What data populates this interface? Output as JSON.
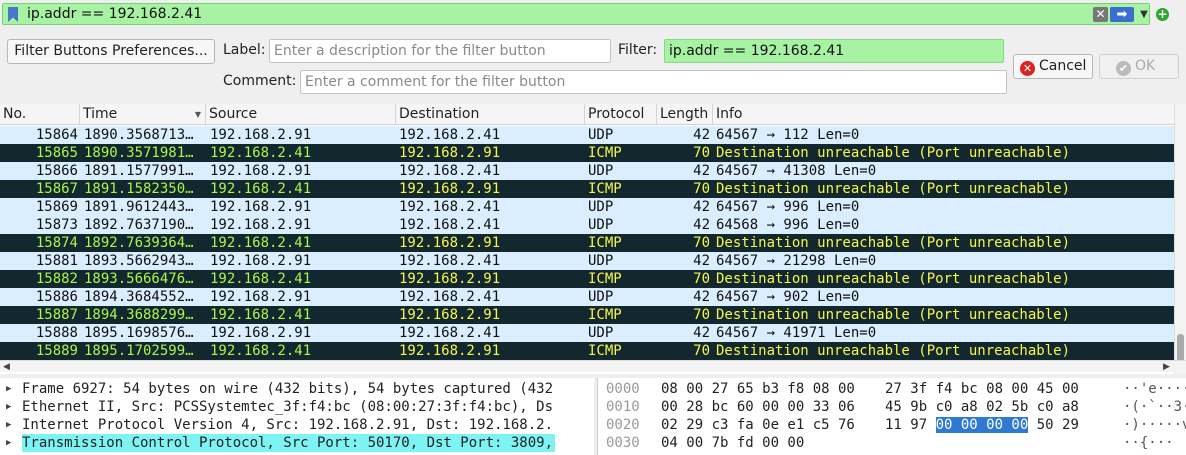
{
  "filter_bar": {
    "value": "ip.addr == 192.168.2.41",
    "clear_icon": "clear-icon",
    "apply_icon": "apply-arrow-icon",
    "dropdown_icon": "chevron-down-icon",
    "add_icon": "add-filter-button-icon"
  },
  "prefs_panel": {
    "prefs_button": "Filter Buttons Preferences...",
    "label_label": "Label:",
    "label_placeholder": "Enter a description for the filter button",
    "filter_label": "Filter:",
    "filter_value": "ip.addr == 192.168.2.41",
    "comment_label": "Comment:",
    "comment_placeholder": "Enter a comment for the filter button",
    "cancel_button": "Cancel",
    "ok_button": "OK"
  },
  "packet_list": {
    "columns": [
      "No.",
      "Time",
      "Source",
      "Destination",
      "Protocol",
      "Length",
      "Info"
    ],
    "rows": [
      {
        "no": "15864",
        "time": "1890.3568713…",
        "src": "192.168.2.91",
        "dst": "192.168.2.41",
        "proto": "UDP",
        "len": "42",
        "info": "64567 → 112 Len=0",
        "kind": "udp"
      },
      {
        "no": "15865",
        "time": "1890.3571981…",
        "src": "192.168.2.41",
        "dst": "192.168.2.91",
        "proto": "ICMP",
        "len": "70",
        "info": "Destination unreachable (Port unreachable)",
        "kind": "icmp"
      },
      {
        "no": "15866",
        "time": "1891.1577991…",
        "src": "192.168.2.91",
        "dst": "192.168.2.41",
        "proto": "UDP",
        "len": "42",
        "info": "64567 → 41308 Len=0",
        "kind": "udp"
      },
      {
        "no": "15867",
        "time": "1891.1582350…",
        "src": "192.168.2.41",
        "dst": "192.168.2.91",
        "proto": "ICMP",
        "len": "70",
        "info": "Destination unreachable (Port unreachable)",
        "kind": "icmp"
      },
      {
        "no": "15869",
        "time": "1891.9612443…",
        "src": "192.168.2.91",
        "dst": "192.168.2.41",
        "proto": "UDP",
        "len": "42",
        "info": "64567 → 996 Len=0",
        "kind": "udp"
      },
      {
        "no": "15873",
        "time": "1892.7637190…",
        "src": "192.168.2.91",
        "dst": "192.168.2.41",
        "proto": "UDP",
        "len": "42",
        "info": "64568 → 996 Len=0",
        "kind": "udp"
      },
      {
        "no": "15874",
        "time": "1892.7639364…",
        "src": "192.168.2.41",
        "dst": "192.168.2.91",
        "proto": "ICMP",
        "len": "70",
        "info": "Destination unreachable (Port unreachable)",
        "kind": "icmp"
      },
      {
        "no": "15881",
        "time": "1893.5662943…",
        "src": "192.168.2.91",
        "dst": "192.168.2.41",
        "proto": "UDP",
        "len": "42",
        "info": "64567 → 21298 Len=0",
        "kind": "udp"
      },
      {
        "no": "15882",
        "time": "1893.5666476…",
        "src": "192.168.2.41",
        "dst": "192.168.2.91",
        "proto": "ICMP",
        "len": "70",
        "info": "Destination unreachable (Port unreachable)",
        "kind": "icmp"
      },
      {
        "no": "15886",
        "time": "1894.3684552…",
        "src": "192.168.2.91",
        "dst": "192.168.2.41",
        "proto": "UDP",
        "len": "42",
        "info": "64567 → 902 Len=0",
        "kind": "udp"
      },
      {
        "no": "15887",
        "time": "1894.3688299…",
        "src": "192.168.2.41",
        "dst": "192.168.2.91",
        "proto": "ICMP",
        "len": "70",
        "info": "Destination unreachable (Port unreachable)",
        "kind": "icmp"
      },
      {
        "no": "15888",
        "time": "1895.1698576…",
        "src": "192.168.2.91",
        "dst": "192.168.2.41",
        "proto": "UDP",
        "len": "42",
        "info": "64567 → 41971 Len=0",
        "kind": "udp"
      },
      {
        "no": "15889",
        "time": "1895.1702599…",
        "src": "192.168.2.41",
        "dst": "192.168.2.91",
        "proto": "ICMP",
        "len": "70",
        "info": "Destination unreachable (Port unreachable)",
        "kind": "icmp"
      }
    ]
  },
  "details": [
    {
      "text": "Frame 6927: 54 bytes on wire (432 bits), 54 bytes captured (432",
      "selected": false
    },
    {
      "text": "Ethernet II, Src: PCSSystemtec_3f:f4:bc (08:00:27:3f:f4:bc), Ds",
      "selected": false
    },
    {
      "text": "Internet Protocol Version 4, Src: 192.168.2.91, Dst: 192.168.2.",
      "selected": false
    },
    {
      "text": "Transmission Control Protocol, Src Port: 50170, Dst Port: 3809,",
      "selected": true
    }
  ],
  "bytes": [
    {
      "offset": "0000",
      "hex1": "08 00 27 65 b3 f8 08 00",
      "hex2": "27 3f f4 bc 08 00 45 00",
      "hl": "",
      "hex2b": "",
      "ascii": "··'e····"
    },
    {
      "offset": "0010",
      "hex1": "00 28 bc 60 00 00 33 06",
      "hex2": "45 9b c0 a8 02 5b c0 a8",
      "hl": "",
      "hex2b": "",
      "ascii": "·(·`··3·"
    },
    {
      "offset": "0020",
      "hex1": "02 29 c3 fa 0e e1 c5 76",
      "hex2": "11 97 ",
      "hl": "00 00 00 00",
      "hex2b": "50 29",
      "ascii": "·)·····v"
    },
    {
      "offset": "0030",
      "hex1": "04 00 7b fd 00 00",
      "hex2": "",
      "hl": "",
      "hex2b": "",
      "ascii": "··{···"
    }
  ]
}
